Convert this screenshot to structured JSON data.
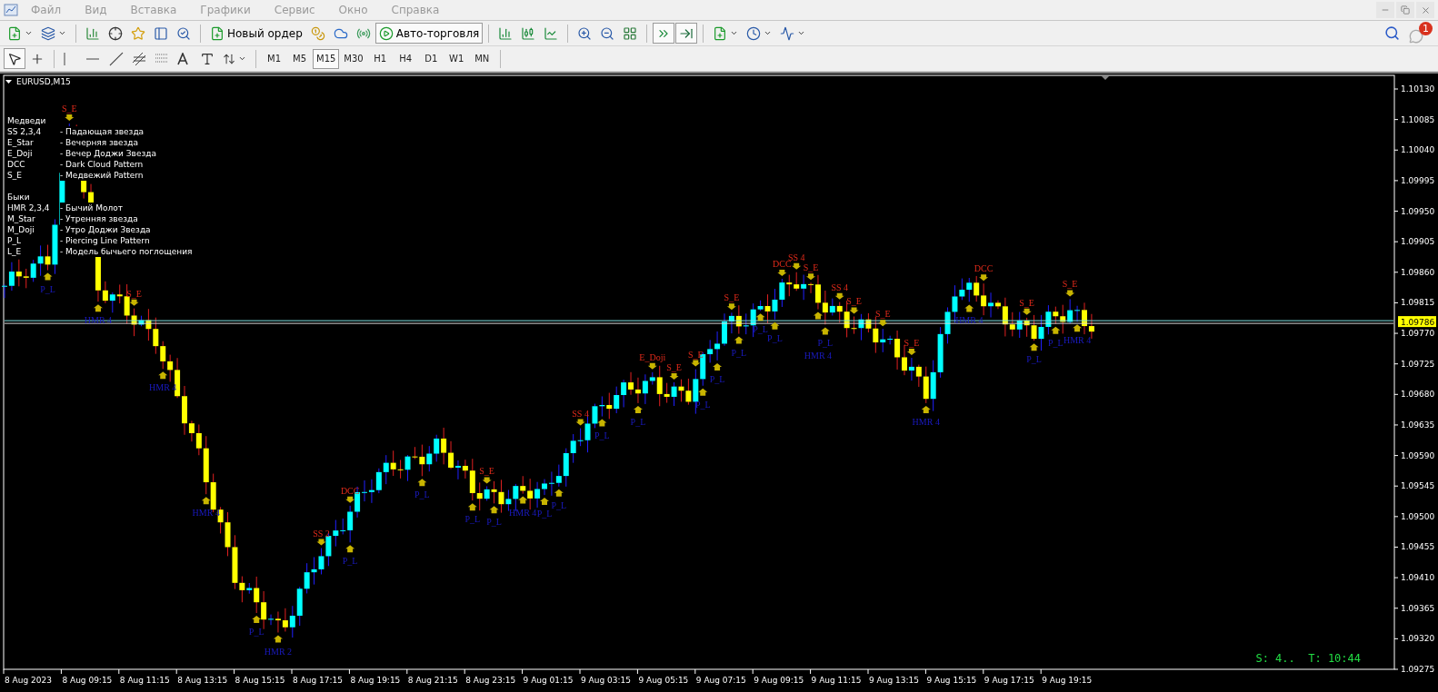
{
  "menu": {
    "items": [
      "Файл",
      "Вид",
      "Вставка",
      "Графики",
      "Сервис",
      "Окно",
      "Справка"
    ]
  },
  "toolbar": {
    "new_order": "Новый ордер",
    "auto_trading": {
      "label": "Авто-торговля",
      "on": true
    },
    "autoscroll": {
      "on": true
    },
    "chart_shift": {
      "on": true
    },
    "notifications_badge": "1"
  },
  "drawing_toolbar": {
    "tools": [
      {
        "kind": "cursor",
        "selected": true
      },
      {
        "kind": "crosshair",
        "selected": false
      },
      {
        "kind": "vline",
        "selected": false
      },
      {
        "kind": "hline",
        "selected": false
      },
      {
        "kind": "trendline",
        "selected": false
      },
      {
        "kind": "channel",
        "selected": false
      },
      {
        "kind": "fibo",
        "selected": false
      },
      {
        "kind": "text",
        "selected": false
      },
      {
        "kind": "label",
        "selected": false
      },
      {
        "kind": "arrows",
        "selected": false
      }
    ],
    "timeframes": [
      {
        "label": "M1",
        "selected": false
      },
      {
        "label": "M5",
        "selected": false
      },
      {
        "label": "M15",
        "selected": true
      },
      {
        "label": "M30",
        "selected": false
      },
      {
        "label": "H1",
        "selected": false
      },
      {
        "label": "H4",
        "selected": false
      },
      {
        "label": "D1",
        "selected": false
      },
      {
        "label": "W1",
        "selected": false
      },
      {
        "label": "MN",
        "selected": false
      }
    ]
  },
  "chart": {
    "symbol": "EURUSD,M15",
    "legend": [
      {
        "title": "Медведи",
        "rows": [
          {
            "code": "SS 2,3,4",
            "text": "- Падающая звезда"
          },
          {
            "code": "E_Star",
            "text": "- Вечерняя звезда"
          },
          {
            "code": "E_Doji",
            "text": "- Вечер Доджи Звезда"
          },
          {
            "code": "DCC",
            "text": "- Dark Cloud Pattern"
          },
          {
            "code": "S_E",
            "text": "- Медвежий Pattern"
          }
        ]
      },
      {
        "title": "Быки",
        "rows": [
          {
            "code": "HMR 2,3,4",
            "text": "- Бычий Молот"
          },
          {
            "code": "M_Star",
            "text": "- Утренняя звезда"
          },
          {
            "code": "M_Doji",
            "text": "- Утро Доджи Звезда"
          },
          {
            "code": "P_L",
            "text": "- Piercing Line Pattern"
          },
          {
            "code": "L_E",
            "text": "- Модель бычьего поглощения"
          }
        ]
      }
    ],
    "price_axis": [
      "1.10130",
      "1.10085",
      "1.10040",
      "1.09995",
      "1.09950",
      "1.09905",
      "1.09860",
      "1.09815",
      "1.09770",
      "1.09725",
      "1.09680",
      "1.09635",
      "1.09590",
      "1.09545",
      "1.09500",
      "1.09455",
      "1.09410",
      "1.09365",
      "1.09320",
      "1.09275"
    ],
    "current_price": "1.09786",
    "time_axis": [
      "8 Aug 2023",
      "8 Aug 09:15",
      "8 Aug 11:15",
      "8 Aug 13:15",
      "8 Aug 15:15",
      "8 Aug 17:15",
      "8 Aug 19:15",
      "8 Aug 21:15",
      "8 Aug 23:15",
      "9 Aug 01:15",
      "9 Aug 03:15",
      "9 Aug 05:15",
      "9 Aug 07:15",
      "9 Aug 09:15",
      "9 Aug 11:15",
      "9 Aug 13:15",
      "9 Aug 15:15",
      "9 Aug 17:15",
      "9 Aug 19:15"
    ],
    "patterns": [
      {
        "label": "S_E",
        "kind": "bear"
      },
      {
        "label": "S_E",
        "kind": "bear"
      },
      {
        "label": "SS 2",
        "kind": "bear"
      },
      {
        "label": "DCC",
        "kind": "bear"
      },
      {
        "label": "S_E",
        "kind": "bear"
      },
      {
        "label": "SS 4",
        "kind": "bear"
      },
      {
        "label": "E_Doji",
        "kind": "bear"
      },
      {
        "label": "S_E",
        "kind": "bear"
      },
      {
        "label": "S_E",
        "kind": "bear"
      },
      {
        "label": "S_E",
        "kind": "bear"
      },
      {
        "label": "DCC",
        "kind": "bear"
      },
      {
        "label": "SS 4",
        "kind": "bear"
      },
      {
        "label": "S_E",
        "kind": "bear"
      },
      {
        "label": "SS 4",
        "kind": "bear"
      },
      {
        "label": "S_E",
        "kind": "bear"
      },
      {
        "label": "S_E",
        "kind": "bear"
      },
      {
        "label": "S_E",
        "kind": "bear"
      },
      {
        "label": "DCC",
        "kind": "bear"
      },
      {
        "label": "S_E",
        "kind": "bear"
      },
      {
        "label": "S_E",
        "kind": "bear"
      },
      {
        "label": "P_L",
        "kind": "bull"
      },
      {
        "label": "HMR 4",
        "kind": "bull"
      },
      {
        "label": "HMR 4",
        "kind": "bull"
      },
      {
        "label": "HMR 4",
        "kind": "bull"
      },
      {
        "label": "P_L",
        "kind": "bull"
      },
      {
        "label": "HMR 2",
        "kind": "bull"
      },
      {
        "label": "P_L",
        "kind": "bull"
      },
      {
        "label": "P_L",
        "kind": "bull"
      },
      {
        "label": "P_L",
        "kind": "bull"
      },
      {
        "label": "P_L",
        "kind": "bull"
      },
      {
        "label": "HMR 4",
        "kind": "bull"
      },
      {
        "label": "P_L",
        "kind": "bull"
      },
      {
        "label": "P_L",
        "kind": "bull"
      },
      {
        "label": "P_L",
        "kind": "bull"
      },
      {
        "label": "P_L",
        "kind": "bull"
      },
      {
        "label": "P_L",
        "kind": "bull"
      },
      {
        "label": "P_L",
        "kind": "bull"
      },
      {
        "label": "P_L",
        "kind": "bull"
      },
      {
        "label": "P_L",
        "kind": "bull"
      },
      {
        "label": "P_L",
        "kind": "bull"
      },
      {
        "label": "P_L",
        "kind": "bull"
      },
      {
        "label": "HMR 4",
        "kind": "bull"
      },
      {
        "label": "HMR 4",
        "kind": "bull"
      },
      {
        "label": "HMR 4",
        "kind": "bull"
      },
      {
        "label": "P_L",
        "kind": "bull"
      },
      {
        "label": "P_L",
        "kind": "bull"
      },
      {
        "label": "HMR 4",
        "kind": "bull"
      }
    ],
    "status": "S: 4..  T: 10:44"
  }
}
